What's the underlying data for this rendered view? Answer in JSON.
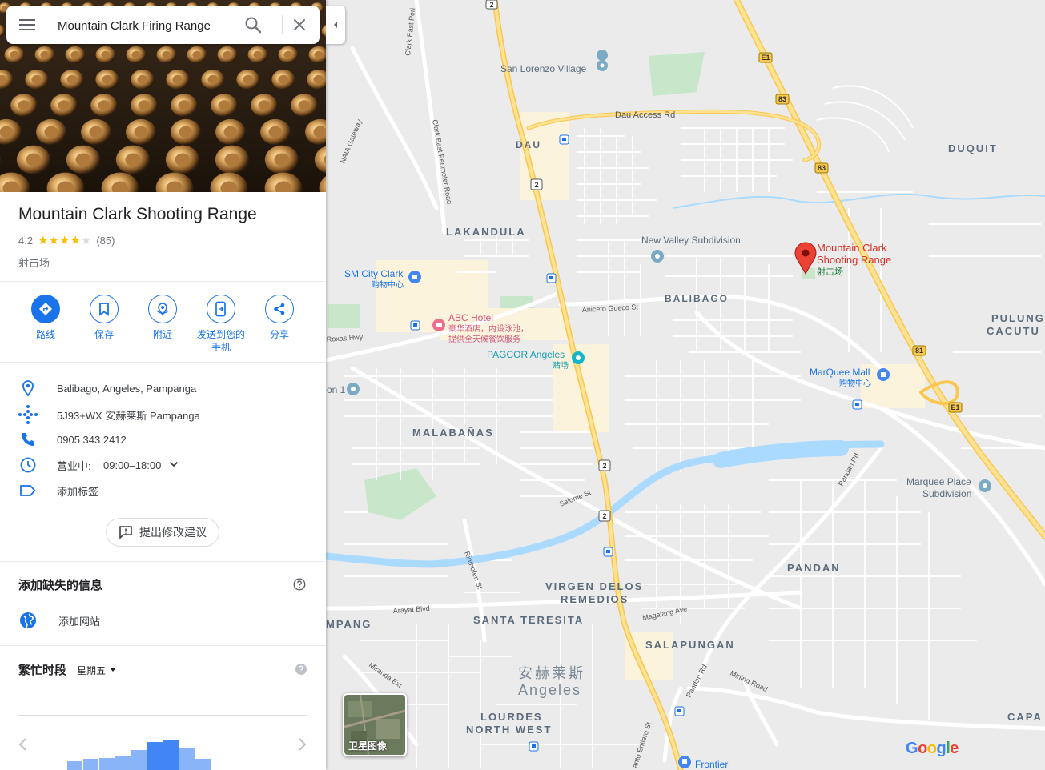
{
  "search": {
    "value": "Mountain Clark Firing Range",
    "menu_icon": "menu-icon",
    "search_icon": "search-icon",
    "clear_icon": "close-icon"
  },
  "place": {
    "title": "Mountain Clark Shooting Range",
    "rating": "4.2",
    "stars_filled": 4,
    "review_count": "(85)",
    "category": "射击场"
  },
  "actions": [
    {
      "label": "路线",
      "icon": "directions-icon"
    },
    {
      "label": "保存",
      "icon": "bookmark-icon"
    },
    {
      "label": "附近",
      "icon": "nearby-icon"
    },
    {
      "label": "发送到您的\n手机",
      "icon": "send-to-phone-icon"
    },
    {
      "label": "分享",
      "icon": "share-icon"
    }
  ],
  "info": {
    "address": "Balibago, Angeles, Pampanga",
    "plus_code": "5J93+WX 安赫莱斯 Pampanga",
    "phone": "0905 343 2412",
    "hours_status": "营业中:",
    "hours": "09:00–18:00",
    "add_label": "添加标签"
  },
  "suggest_edit": "提出修改建议",
  "missing_info": {
    "title": "添加缺失的信息",
    "add_website": "添加网站"
  },
  "popular_times": {
    "title": "繁忙时段",
    "day": "星期五",
    "bars": [
      0.18,
      0.22,
      0.24,
      0.28,
      0.4,
      0.56,
      0.6,
      0.44,
      0.22
    ],
    "highlight": [
      5,
      6
    ]
  },
  "map": {
    "satellite_label": "卫星图像",
    "google_logo": "Google",
    "labels": {
      "san_lorenzo": "San Lorenzo Village",
      "dau_access": "Dau Access Rd",
      "dau": "DAU",
      "duquit": "DUQUIT",
      "lakandula": "LAKANDULA",
      "new_valley": "New Valley Subdivision",
      "marker1": "Mountain Clark",
      "marker2": "Shooting Range",
      "marker3": "射击场",
      "sm1": "SM City Clark",
      "sm2": "购物中心",
      "abc1": "ABC Hotel",
      "abc2": "豪华酒店，内设泳池，",
      "abc3": "提供全天候餐饮服务",
      "pagcor1": "PAGCOR Angeles",
      "pagcor2": "赌场",
      "aniceto": "Aniceto Gueco St",
      "balibago": "BALIBAGO",
      "pulung1": "PULUNG",
      "pulung2": "CACUTU",
      "marquee1": "MarQuee Mall",
      "marquee2": "购物中心",
      "roxas": "Roxas Hwy",
      "on1": "on 1",
      "malabanas": "MALABAÑAS",
      "marquee_place1": "Marquee Place",
      "marquee_place2": "Subdivision",
      "salome": "Salome St",
      "pandan_rd": "Pandan Rd",
      "pandan": "PANDAN",
      "virgen1": "VIRGEN DELOS",
      "virgen2": "REMEDIOS",
      "rinthofen": "Rinthofen St",
      "arayat": "Arayat Blvd",
      "mpang": "MPANG",
      "santa": "SANTA TERESITA",
      "magalang": "Magalang Ave",
      "salapungan": "SALAPUNGAN",
      "miranda": "Miranda Ext",
      "angeles_cn": "安赫莱斯",
      "angeles": "Angeles",
      "pandan_rd2": "Pandan Rd",
      "mining": "Mining Road",
      "lourdes1": "LOURDES",
      "lourdes2": "NORTH WEST",
      "santo": "anto Entiero St",
      "frontier": "Frontier",
      "capa": "CAPA",
      "naia": "NAIA Gateway",
      "clark_east": "Clark East Perimeter Road",
      "clark_east2": "Clark East Peri",
      "e1": "E1",
      "r83": "83",
      "r81": "81",
      "r2": "2"
    }
  }
}
